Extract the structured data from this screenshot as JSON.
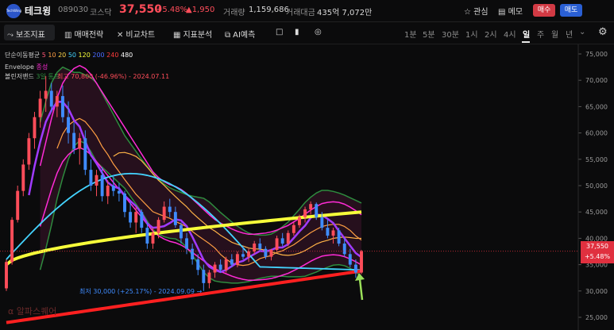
{
  "header": {
    "logo_text": "TechWing",
    "name": "테크윙",
    "code": "089030",
    "market": "코스닥",
    "price": "37,550",
    "change_pct": "+5.48%",
    "change_abs": "▲1,950",
    "volume_label": "거래량",
    "volume_value": "1,159,686",
    "amount_label": "거래대금",
    "amount_value": "435억 7,072만",
    "watch_label": "관심",
    "memo_label": "메모",
    "buy_label": "매수",
    "sell_label": "매도"
  },
  "toolbar": {
    "indicators": "보조지표",
    "strategy": "매매전략",
    "compare": "비교차트",
    "analysis": "지표분석",
    "ai": "AI예측",
    "periods": [
      "1분",
      "5분",
      "30분",
      "1시",
      "2시",
      "4시",
      "일",
      "주",
      "월",
      "년"
    ],
    "active_period": "일"
  },
  "legend": {
    "ma_title": "단순이동평균",
    "ma_periods": [
      "5",
      "10",
      "20",
      "50",
      "120",
      "200",
      "240",
      "480"
    ],
    "ma_colors": [
      "#ff5577",
      "#ff9f43",
      "#ffd64a",
      "#44d4ff",
      "#f7ff3a",
      "#4a6bff",
      "#ff3b3b",
      "#ffffff"
    ],
    "envelope": "Envelope",
    "envelope_value": "종성",
    "bollinger": "볼린저밴드",
    "bollinger_value": "3일 통트",
    "high_note": "최고 70,800 (-46.96%) - 2024.07.11",
    "low_note": "최저 30,000 (+25.17%) - 2024.09.09 →"
  },
  "price_tag": {
    "price": "37,550",
    "pct": "+5.48%"
  },
  "watermark": "알파스퀘어",
  "colors": {
    "up": "#ff4d5a",
    "down": "#3f8cff",
    "ma20": "#ffb347",
    "bb": "#2e8b3e",
    "envelope": "#ff2bd6"
  },
  "chart_data": {
    "type": "candlestick",
    "ylim": [
      25000,
      75000
    ],
    "y_ticks": [
      75000,
      70000,
      65000,
      60000,
      55000,
      50000,
      45000,
      40000,
      35000,
      30000,
      25000
    ],
    "last_price": 37550,
    "ohlc": [
      [
        30500,
        36000,
        30000,
        35500
      ],
      [
        35500,
        44000,
        35000,
        43500
      ],
      [
        43500,
        50000,
        43000,
        49000
      ],
      [
        49000,
        55000,
        48000,
        54000
      ],
      [
        54000,
        60000,
        53000,
        59000
      ],
      [
        59000,
        64000,
        57000,
        63000
      ],
      [
        63000,
        68000,
        61000,
        66500
      ],
      [
        66500,
        70800,
        64000,
        68000
      ],
      [
        68000,
        69500,
        64000,
        65000
      ],
      [
        65000,
        68000,
        63000,
        67000
      ],
      [
        67000,
        69000,
        62000,
        63000
      ],
      [
        63000,
        66000,
        58000,
        60000
      ],
      [
        60000,
        62000,
        56000,
        57000
      ],
      [
        57000,
        60000,
        54000,
        59000
      ],
      [
        59000,
        60500,
        52000,
        53000
      ],
      [
        53000,
        55000,
        49000,
        50000
      ],
      [
        50000,
        53000,
        48000,
        52000
      ],
      [
        52000,
        53500,
        47000,
        48000
      ],
      [
        48000,
        51000,
        46500,
        50000
      ],
      [
        50000,
        52000,
        48000,
        49000
      ],
      [
        49000,
        50500,
        47000,
        48500
      ],
      [
        48500,
        49000,
        44000,
        45000
      ],
      [
        45000,
        47000,
        42000,
        43000
      ],
      [
        43000,
        46000,
        41000,
        45000
      ],
      [
        45000,
        45500,
        41000,
        42000
      ],
      [
        42000,
        43000,
        38000,
        39000
      ],
      [
        39000,
        42000,
        38000,
        41000
      ],
      [
        41000,
        44000,
        40000,
        43500
      ],
      [
        43500,
        47000,
        43000,
        46000
      ],
      [
        46000,
        47500,
        44000,
        45000
      ],
      [
        45000,
        46000,
        42000,
        42500
      ],
      [
        42500,
        43000,
        39000,
        40000
      ],
      [
        40000,
        41000,
        37000,
        38000
      ],
      [
        38000,
        39000,
        35000,
        36000
      ],
      [
        36000,
        37000,
        33000,
        34000
      ],
      [
        34000,
        35000,
        30000,
        31500
      ],
      [
        31500,
        34000,
        30500,
        33500
      ],
      [
        33500,
        35500,
        32500,
        35000
      ],
      [
        35000,
        36000,
        33500,
        34000
      ],
      [
        34000,
        36500,
        33500,
        36000
      ],
      [
        36000,
        37000,
        34500,
        35000
      ],
      [
        35000,
        37500,
        34500,
        37000
      ],
      [
        37000,
        38500,
        36000,
        36500
      ],
      [
        36500,
        38000,
        35500,
        37500
      ],
      [
        37500,
        39500,
        37000,
        39000
      ],
      [
        39000,
        40000,
        37500,
        38000
      ],
      [
        38000,
        38500,
        36000,
        36500
      ],
      [
        36500,
        38000,
        35800,
        37800
      ],
      [
        37800,
        40500,
        37500,
        40000
      ],
      [
        40000,
        41000,
        38500,
        39000
      ],
      [
        39000,
        41500,
        38500,
        41000
      ],
      [
        41000,
        43000,
        40500,
        42500
      ],
      [
        42500,
        44500,
        42000,
        44000
      ],
      [
        44000,
        46000,
        43000,
        45500
      ],
      [
        45500,
        47000,
        44500,
        46500
      ],
      [
        46500,
        46800,
        43500,
        44000
      ],
      [
        44000,
        45000,
        41500,
        42000
      ],
      [
        42000,
        43500,
        40000,
        40500
      ],
      [
        40500,
        42000,
        39000,
        41500
      ],
      [
        41500,
        42000,
        38500,
        39000
      ],
      [
        39000,
        40000,
        36500,
        37000
      ],
      [
        37000,
        38000,
        34500,
        35000
      ],
      [
        35000,
        36000,
        32500,
        33500
      ],
      [
        33500,
        37800,
        33200,
        37550
      ]
    ],
    "bb_mid": [
      null,
      null,
      null,
      null,
      null,
      null,
      48000,
      52000,
      56000,
      59500,
      62000,
      63500,
      64500,
      65000,
      64500,
      63500,
      62000,
      60500,
      59000,
      57500,
      56000,
      54500,
      53000,
      51500,
      50000,
      48500,
      47000,
      46000,
      45300,
      44800,
      44500,
      44000,
      43300,
      42400,
      41500,
      40600,
      39700,
      38900,
      38300,
      37800,
      37300,
      36900,
      36600,
      36400,
      36400,
      36500,
      36600,
      36800,
      37100,
      37500,
      37900,
      38500,
      39100,
      39800,
      40500,
      41100,
      41600,
      41800,
      41900,
      41800,
      41500,
      41000,
      40400,
      39700
    ],
    "bb_width": [
      null,
      null,
      null,
      null,
      null,
      null,
      14000,
      14000,
      13500,
      12000,
      10500,
      8500,
      7000,
      6500,
      6500,
      7000,
      7500,
      7000,
      6500,
      6000,
      5500,
      5000,
      5000,
      5000,
      5000,
      5200,
      5400,
      5200,
      5000,
      4800,
      4600,
      4700,
      5000,
      5600,
      6300,
      7000,
      7200,
      7000,
      6600,
      6200,
      5800,
      5400,
      5000,
      4600,
      4300,
      4100,
      4000,
      4000,
      4300,
      4700,
      5200,
      5800,
      6400,
      7000,
      7300,
      7500,
      7500,
      7300,
      7000,
      6800,
      6700,
      6700,
      6800,
      7000
    ]
  }
}
